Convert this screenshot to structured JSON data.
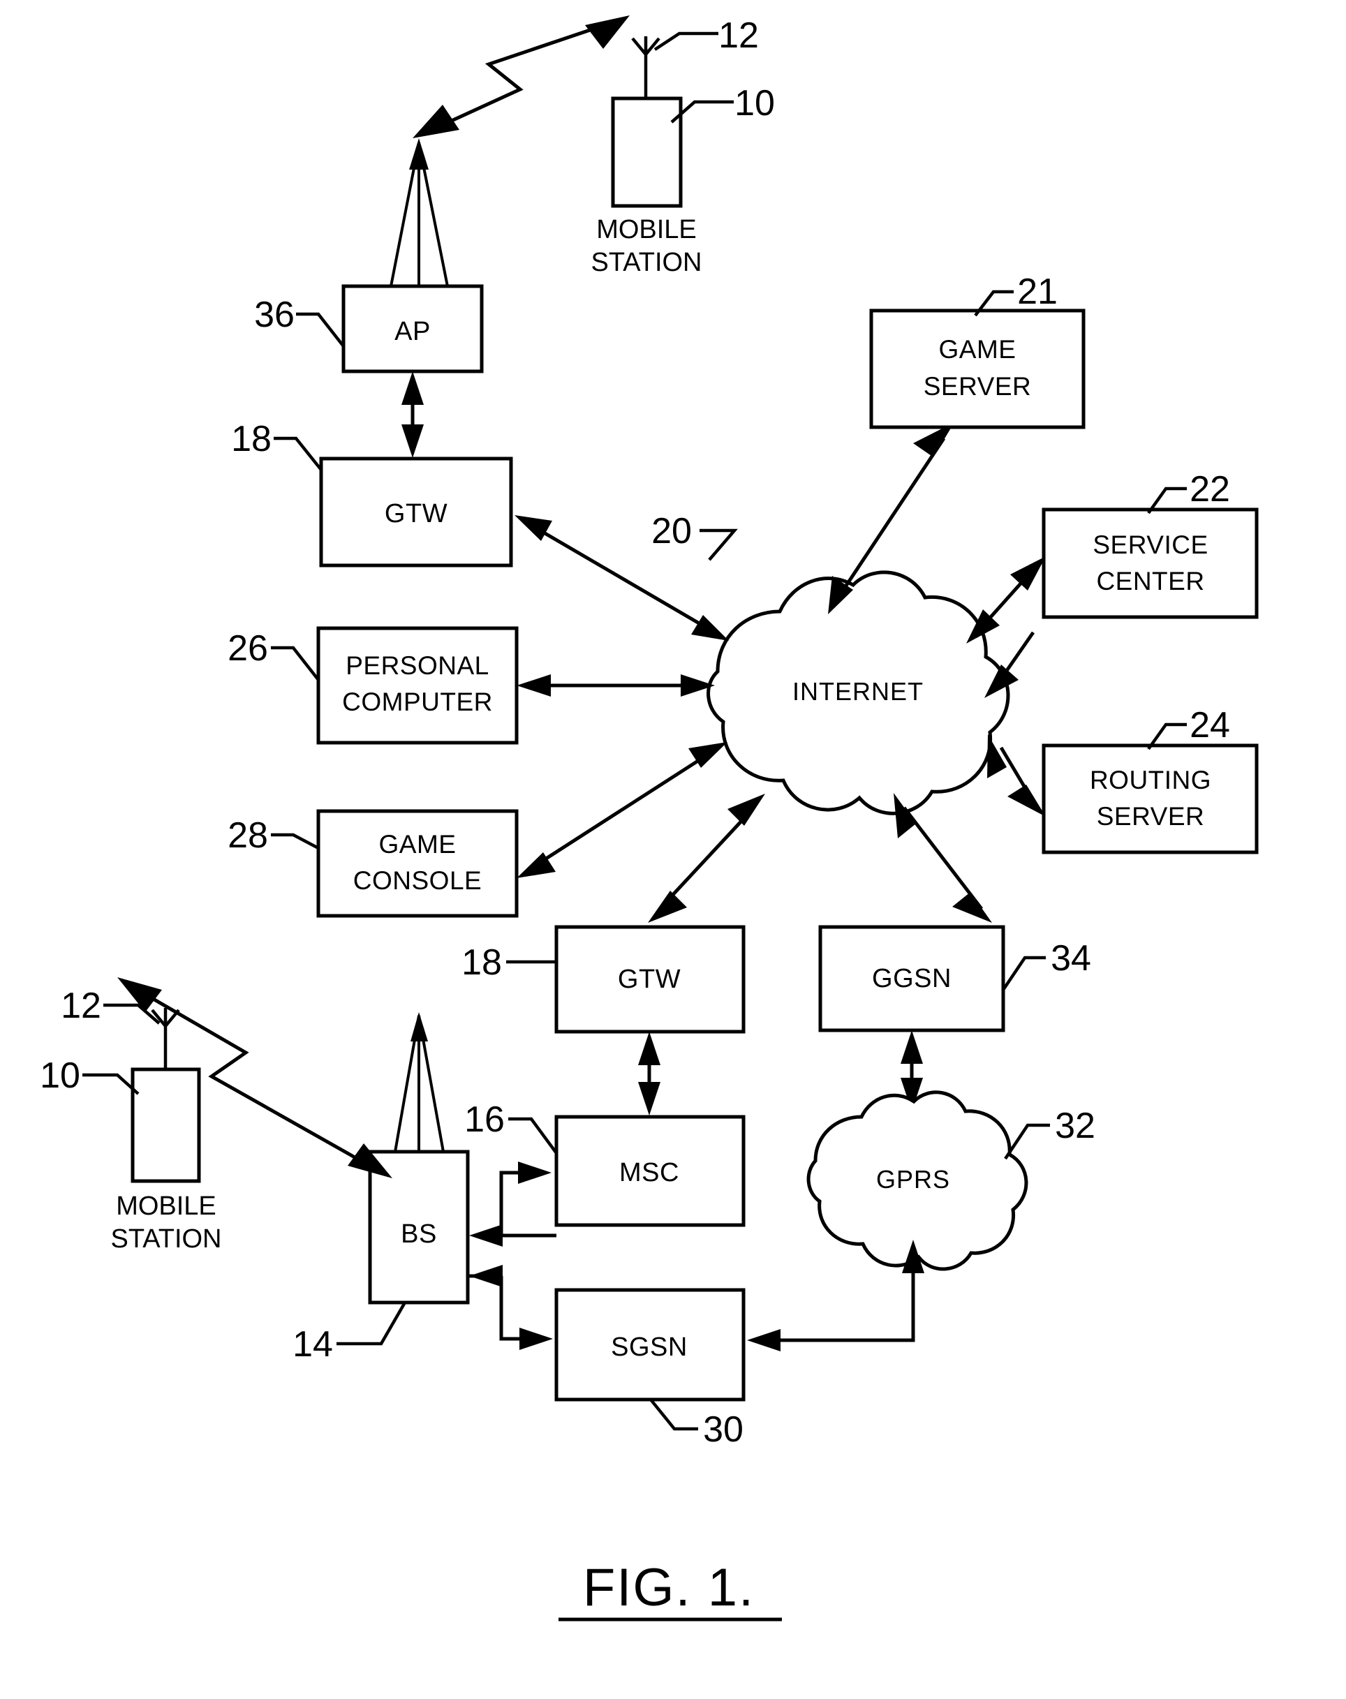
{
  "figure": {
    "caption": "FIG. 1.",
    "title": "Network architecture block diagram"
  },
  "nodes": [
    {
      "id": "mobile_station_top",
      "label": "",
      "under_label_line1": "MOBILE",
      "under_label_line2": "STATION",
      "ref": "10",
      "kind": "handset"
    },
    {
      "id": "antenna_top",
      "label": "",
      "ref": "12",
      "kind": "antenna"
    },
    {
      "id": "ap",
      "label": "AP",
      "ref": "36",
      "kind": "box"
    },
    {
      "id": "gtw_top",
      "label": "GTW",
      "ref": "18",
      "kind": "box"
    },
    {
      "id": "internet",
      "label": "INTERNET",
      "ref": "20",
      "kind": "cloud"
    },
    {
      "id": "game_server",
      "label_line1": "GAME",
      "label_line2": "SERVER",
      "ref": "21",
      "kind": "box"
    },
    {
      "id": "service_center",
      "label_line1": "SERVICE",
      "label_line2": "CENTER",
      "ref": "22",
      "kind": "box"
    },
    {
      "id": "routing_server",
      "label_line1": "ROUTING",
      "label_line2": "SERVER",
      "ref": "24",
      "kind": "box"
    },
    {
      "id": "personal_computer",
      "label_line1": "PERSONAL",
      "label_line2": "COMPUTER",
      "ref": "26",
      "kind": "box"
    },
    {
      "id": "game_console",
      "label_line1": "GAME",
      "label_line2": "CONSOLE",
      "ref": "28",
      "kind": "box"
    },
    {
      "id": "gtw_bottom",
      "label": "GTW",
      "ref": "18",
      "kind": "box"
    },
    {
      "id": "ggsn",
      "label": "GGSN",
      "ref": "34",
      "kind": "box"
    },
    {
      "id": "msc",
      "label": "MSC",
      "ref": "16",
      "kind": "box"
    },
    {
      "id": "gprs",
      "label": "GPRS",
      "ref": "32",
      "kind": "cloud"
    },
    {
      "id": "sgsn",
      "label": "SGSN",
      "ref": "30",
      "kind": "box"
    },
    {
      "id": "bs",
      "label": "BS",
      "ref": "14",
      "kind": "box"
    },
    {
      "id": "mobile_station_bottom",
      "label": "",
      "under_label_line1": "MOBILE",
      "under_label_line2": "STATION",
      "ref": "10",
      "kind": "handset"
    },
    {
      "id": "antenna_bottom",
      "label": "",
      "ref": "12",
      "kind": "antenna"
    }
  ],
  "reference_numerals": {
    "n10": "10",
    "n12": "12",
    "n14": "14",
    "n16": "16",
    "n18_top": "18",
    "n18_bottom": "18",
    "n20": "20",
    "n21": "21",
    "n22": "22",
    "n24": "24",
    "n26": "26",
    "n28": "28",
    "n30": "30",
    "n32": "32",
    "n34": "34",
    "n36": "36",
    "n10_bottom": "10",
    "n12_bottom": "12"
  },
  "labels": {
    "ap": "AP",
    "gtw_top": "GTW",
    "internet": "INTERNET",
    "game_server_l1": "GAME",
    "game_server_l2": "SERVER",
    "service_center_l1": "SERVICE",
    "service_center_l2": "CENTER",
    "routing_server_l1": "ROUTING",
    "routing_server_l2": "SERVER",
    "personal_computer_l1": "PERSONAL",
    "personal_computer_l2": "COMPUTER",
    "game_console_l1": "GAME",
    "game_console_l2": "CONSOLE",
    "gtw_bottom": "GTW",
    "ggsn": "GGSN",
    "msc": "MSC",
    "gprs": "GPRS",
    "sgsn": "SGSN",
    "bs": "BS",
    "mobile_station_top_l1": "MOBILE",
    "mobile_station_top_l2": "STATION",
    "mobile_station_bottom_l1": "MOBILE",
    "mobile_station_bottom_l2": "STATION",
    "caption": "FIG. 1."
  },
  "colors": {
    "ink": "#000000",
    "background": "#ffffff"
  },
  "connections": [
    {
      "from": "mobile_station_top",
      "to": "ap_tower",
      "style": "lightning-bidirectional"
    },
    {
      "from": "ap",
      "to": "gtw_top",
      "style": "bidirectional-vertical"
    },
    {
      "from": "gtw_top",
      "to": "internet",
      "style": "bidirectional-diagonal"
    },
    {
      "from": "internet",
      "to": "game_server",
      "style": "bidirectional-diagonal"
    },
    {
      "from": "internet",
      "to": "service_center",
      "style": "bidirectional-diagonal"
    },
    {
      "from": "internet",
      "to": "routing_server",
      "style": "bidirectional-diagonal"
    },
    {
      "from": "personal_computer",
      "to": "internet",
      "style": "bidirectional-horizontal"
    },
    {
      "from": "game_console",
      "to": "internet",
      "style": "bidirectional-diagonal"
    },
    {
      "from": "internet",
      "to": "gtw_bottom",
      "style": "bidirectional-diagonal"
    },
    {
      "from": "internet",
      "to": "ggsn",
      "style": "bidirectional-diagonal"
    },
    {
      "from": "gtw_bottom",
      "to": "msc",
      "style": "bidirectional-vertical"
    },
    {
      "from": "ggsn",
      "to": "gprs",
      "style": "bidirectional-vertical"
    },
    {
      "from": "msc",
      "to": "bs",
      "style": "elbow-arrow"
    },
    {
      "from": "bs",
      "to": "msc",
      "style": "elbow-arrow"
    },
    {
      "from": "sgsn",
      "to": "bs",
      "style": "elbow-arrow"
    },
    {
      "from": "bs",
      "to": "sgsn",
      "style": "elbow-arrow"
    },
    {
      "from": "gprs",
      "to": "sgsn",
      "style": "elbow-arrow"
    },
    {
      "from": "mobile_station_bottom",
      "to": "bs_tower",
      "style": "lightning-bidirectional"
    }
  ]
}
